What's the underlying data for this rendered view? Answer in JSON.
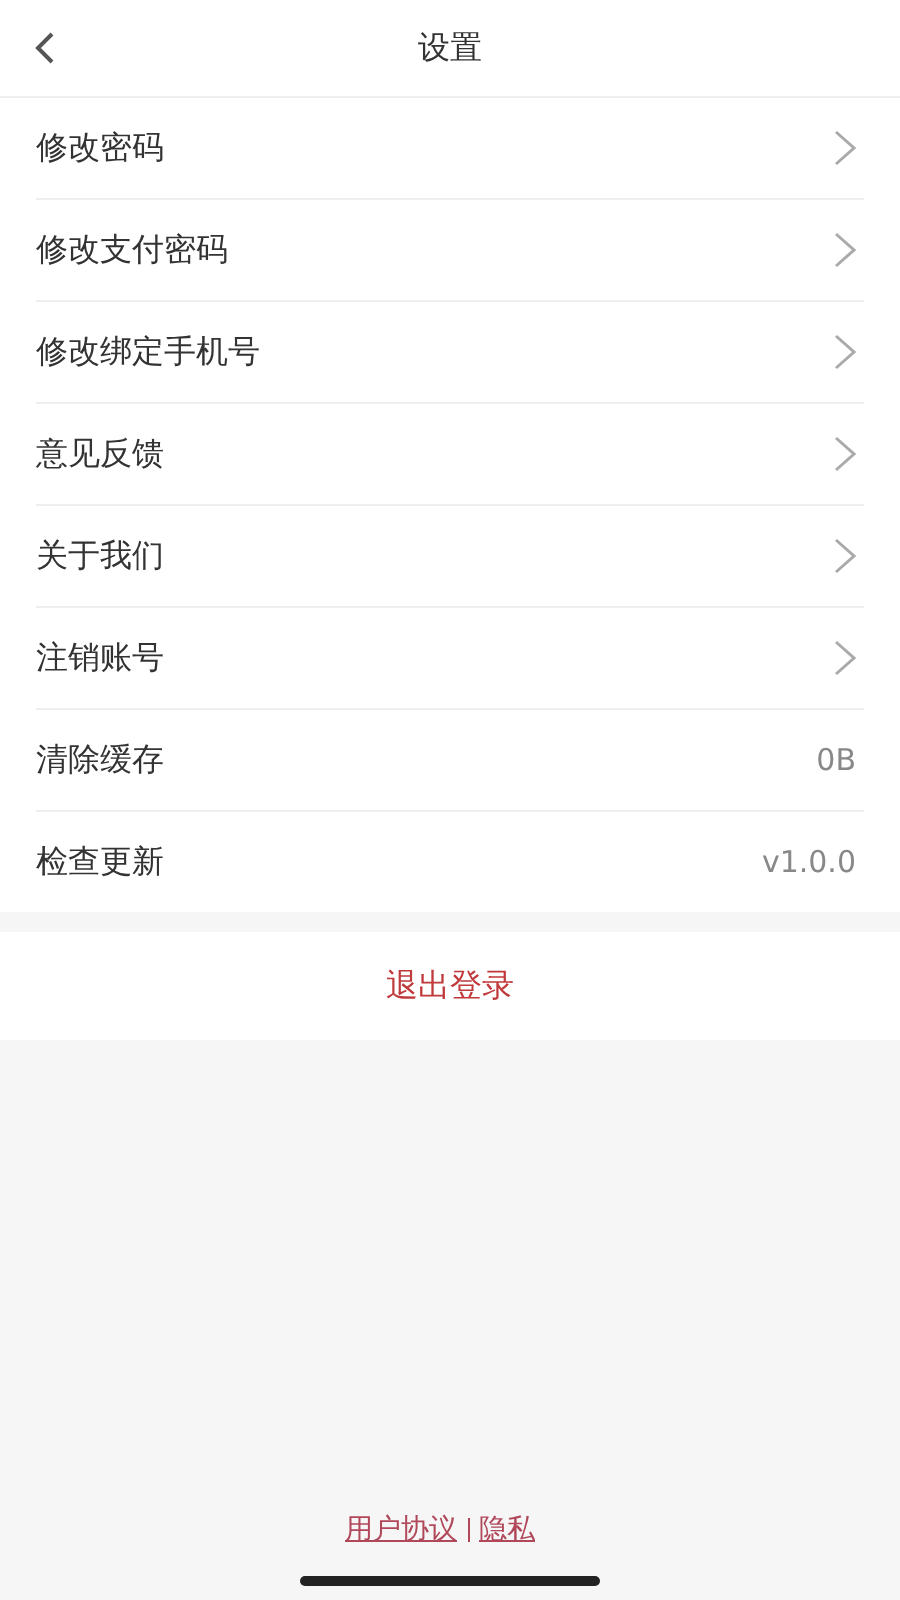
{
  "header": {
    "title": "设置"
  },
  "items": [
    {
      "kind": "link",
      "label": "修改密码"
    },
    {
      "kind": "link",
      "label": "修改支付密码"
    },
    {
      "kind": "link",
      "label": "修改绑定手机号"
    },
    {
      "kind": "link",
      "label": "意见反馈"
    },
    {
      "kind": "link",
      "label": "关于我们"
    },
    {
      "kind": "link",
      "label": "注销账号"
    },
    {
      "kind": "value",
      "label": "清除缓存",
      "value": "0B"
    },
    {
      "kind": "value",
      "label": "检查更新",
      "value": "v1.0.0"
    }
  ],
  "logout": "退出登录",
  "footer_links": [
    "用户协议",
    "隐私"
  ]
}
